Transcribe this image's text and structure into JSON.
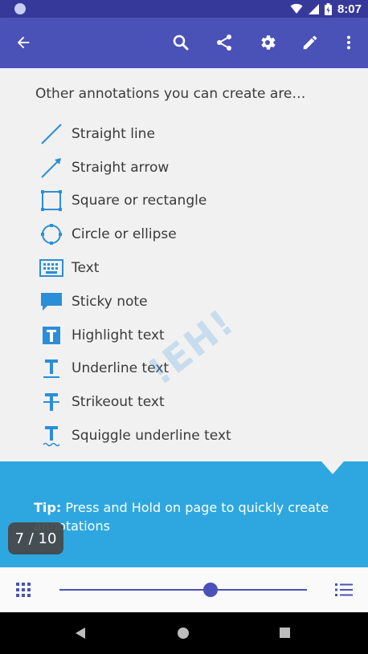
{
  "status_bar": {
    "time": "8:07"
  },
  "toolbar": {
    "back_icon": "arrow-left-icon",
    "actions": [
      "search-icon",
      "share-icon",
      "gear-icon",
      "pencil-icon",
      "more-vert-icon"
    ]
  },
  "content": {
    "intro": "Other annotations you can create are…",
    "annotations": [
      {
        "label": "Straight line",
        "icon": "line-icon"
      },
      {
        "label": "Straight arrow",
        "icon": "arrow-icon"
      },
      {
        "label": "Square or rectangle",
        "icon": "square-icon"
      },
      {
        "label": "Circle or ellipse",
        "icon": "circle-icon"
      },
      {
        "label": "Text",
        "icon": "keyboard-icon"
      },
      {
        "label": "Sticky note",
        "icon": "sticky-note-icon"
      },
      {
        "label": "Highlight text",
        "icon": "highlight-text-icon"
      },
      {
        "label": "Underline text",
        "icon": "underline-text-icon"
      },
      {
        "label": "Strikeout text",
        "icon": "strikeout-text-icon"
      },
      {
        "label": "Squiggle underline text",
        "icon": "squiggle-text-icon"
      }
    ],
    "watermark": "!EH!"
  },
  "tip": {
    "prefix": "Tip:",
    "text": " Press and Hold on page to quickly create annotations"
  },
  "page_indicator": "7 / 10",
  "bottom_bar": {
    "slider_position": 0.61
  },
  "colors": {
    "primary": "#4a52b7",
    "status": "#37399a",
    "accent": "#2ea7e0",
    "icon_blue": "#2b8ed8"
  }
}
